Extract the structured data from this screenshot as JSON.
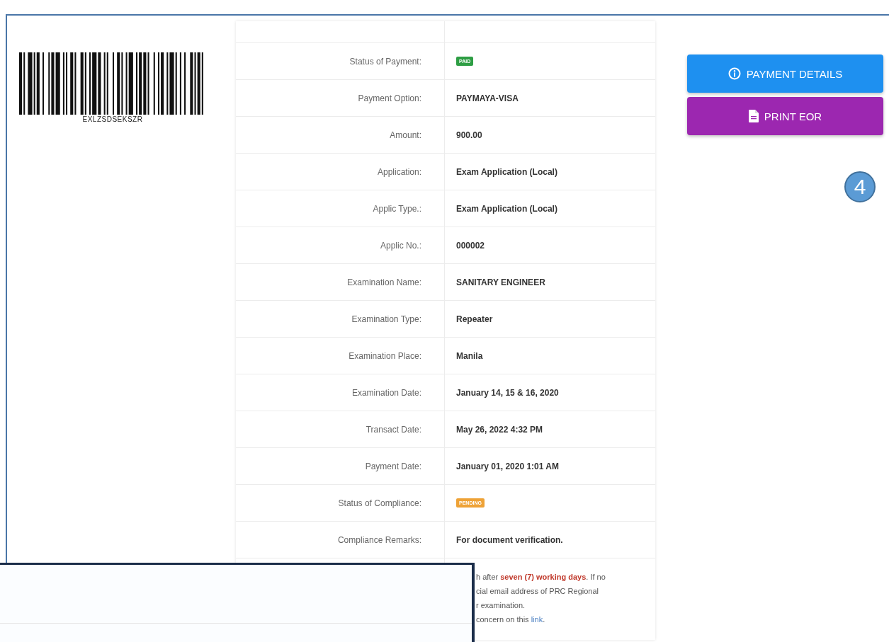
{
  "barcode": {
    "code": "EXLZSDSEKSZR"
  },
  "details": [
    {
      "label": "Status of Payment:",
      "kind": "badge",
      "value": "PAID",
      "color": "#2e9e44"
    },
    {
      "label": "Payment Option:",
      "kind": "text",
      "value": "PAYMAYA-VISA"
    },
    {
      "label": "Amount:",
      "kind": "text",
      "value": "900.00"
    },
    {
      "label": "Application:",
      "kind": "text",
      "value": "Exam Application (Local)"
    },
    {
      "label": "Applic Type.:",
      "kind": "text",
      "value": "Exam Application (Local)"
    },
    {
      "label": "Applic No.:",
      "kind": "text",
      "value": "000002"
    },
    {
      "label": "Examination Name:",
      "kind": "text",
      "value": "SANITARY ENGINEER"
    },
    {
      "label": "Examination Type:",
      "kind": "text",
      "value": "Repeater"
    },
    {
      "label": "Examination Place:",
      "kind": "text",
      "value": "Manila"
    },
    {
      "label": "Examination Date:",
      "kind": "text",
      "value": "January 14, 15 & 16, 2020"
    },
    {
      "label": "Transact Date:",
      "kind": "text",
      "value": "May 26, 2022 4:32 PM"
    },
    {
      "label": "Payment Date:",
      "kind": "text",
      "value": "January 01, 2020 1:01 AM"
    },
    {
      "label": "Status of Compliance:",
      "kind": "badge",
      "value": "PENDING",
      "color": "#eea236"
    },
    {
      "label": "Compliance Remarks:",
      "kind": "text",
      "value": "For document verification."
    }
  ],
  "note_lines": [
    [
      {
        "kind": "plain",
        "text": "h after "
      },
      {
        "kind": "highlight",
        "text": "seven (7) working days"
      },
      {
        "kind": "plain",
        "text": ". If no"
      }
    ],
    [
      {
        "kind": "plain",
        "text": "cial email address of PRC Regional"
      }
    ],
    [
      {
        "kind": "plain",
        "text": "r examination."
      }
    ],
    [
      {
        "kind": "plain",
        "text": "concern on this "
      },
      {
        "kind": "link",
        "text": "link"
      },
      {
        "kind": "plain",
        "text": "."
      }
    ]
  ],
  "buttons": [
    {
      "kind": "info",
      "label": "PAYMENT DETAILS"
    },
    {
      "kind": "print",
      "label": "PRINT EOR"
    }
  ],
  "step_marker": "4"
}
